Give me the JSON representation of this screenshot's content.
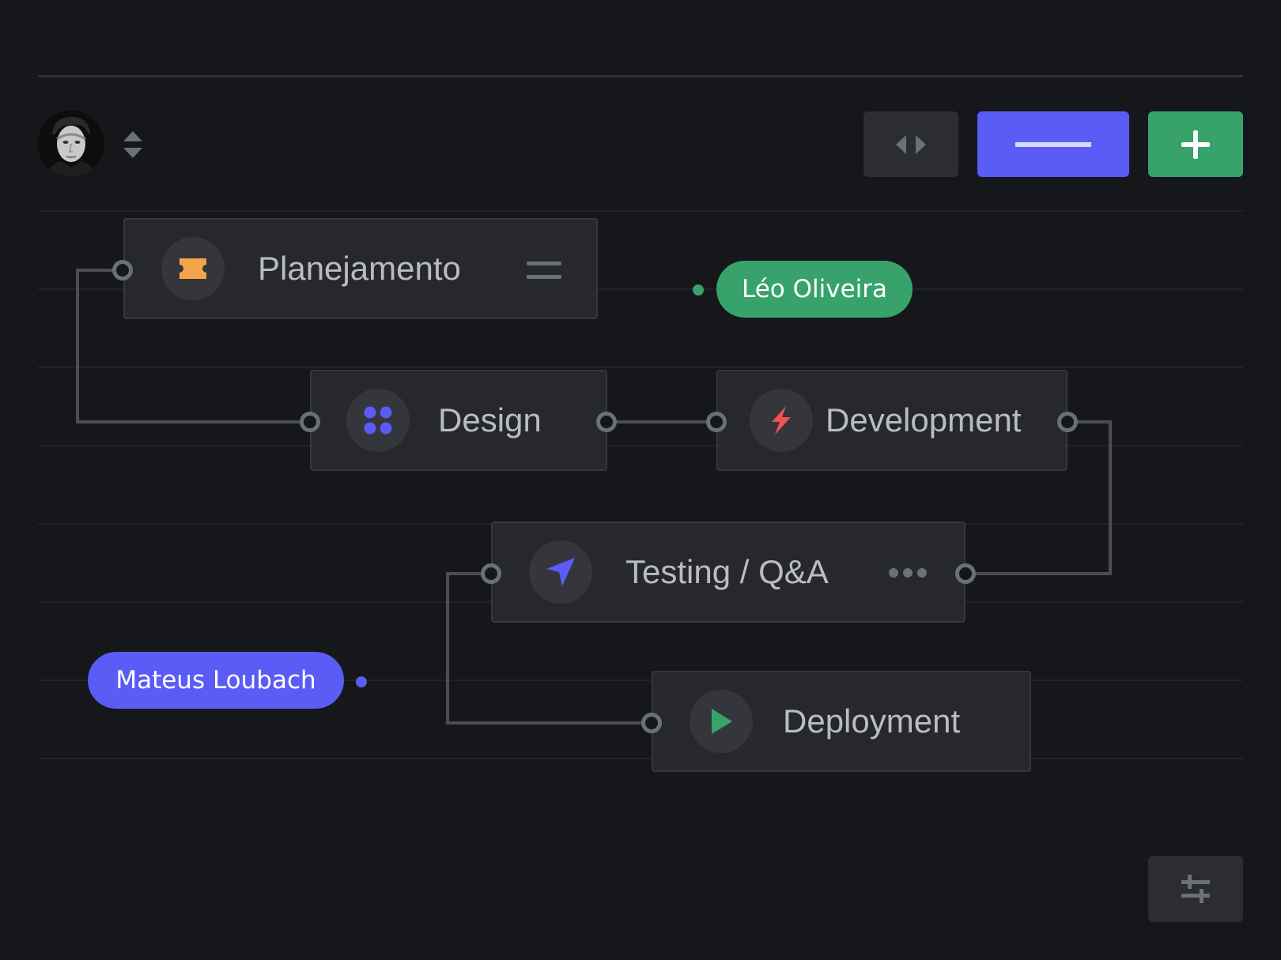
{
  "toolbar": {
    "user_avatar": "avatar",
    "sort_icon": "chevron-up-down-icon",
    "split_button_icon": "arrows-left-right-icon",
    "minus_button_icon": "minus-icon",
    "add_button_icon": "plus-icon",
    "settings_button_icon": "sliders-icon"
  },
  "nodes": [
    {
      "id": "planejamento",
      "label": "Planejamento",
      "icon": "ticket-icon",
      "icon_color": "#f4a54a",
      "action_icon": "drag-handle-icon"
    },
    {
      "id": "design",
      "label": "Design",
      "icon": "four-dots-icon",
      "icon_color": "#5b5cf6"
    },
    {
      "id": "development",
      "label": "Development",
      "icon": "lightning-icon",
      "icon_color": "#ef5350"
    },
    {
      "id": "testing",
      "label": "Testing / Q&A",
      "icon": "navigation-arrow-icon",
      "icon_color": "#5b5cf6",
      "action_icon": "more-horizontal-icon"
    },
    {
      "id": "deployment",
      "label": "Deployment",
      "icon": "play-icon",
      "icon_color": "#37a36b"
    }
  ],
  "collaborators": [
    {
      "name": "Léo Oliveira",
      "color": "#37a36b"
    },
    {
      "name": "Mateus Loubach",
      "color": "#5b5cf6"
    }
  ],
  "colors": {
    "background": "#16171a",
    "node_background": "#26282c",
    "node_border": "#36383d",
    "connector": "#4a4d53",
    "accent_blue": "#5b5cf6",
    "accent_green": "#37a36b"
  }
}
